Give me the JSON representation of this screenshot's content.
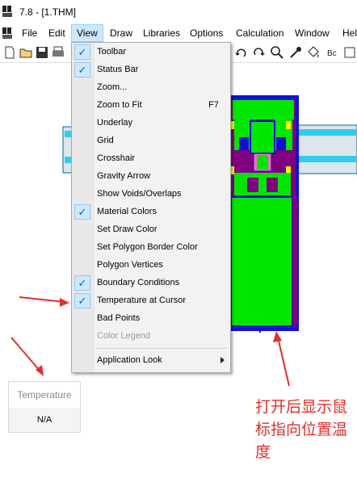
{
  "window": {
    "title": "7.8 - [1.THM]"
  },
  "menubar": {
    "items": [
      "File",
      "Edit",
      "View",
      "Draw",
      "Libraries",
      "Options",
      "Calculation",
      "Window",
      "Hel"
    ]
  },
  "view_menu": {
    "items": [
      {
        "label": "Toolbar",
        "checked": true
      },
      {
        "label": "Status Bar",
        "checked": true
      },
      {
        "label": "Zoom..."
      },
      {
        "label": "Zoom to Fit",
        "shortcut": "F7"
      },
      {
        "label": "Underlay"
      },
      {
        "label": "Grid"
      },
      {
        "label": "Crosshair"
      },
      {
        "label": "Gravity Arrow"
      },
      {
        "label": "Show Voids/Overlaps"
      },
      {
        "label": "Material Colors",
        "checked": true
      },
      {
        "label": "Set Draw Color"
      },
      {
        "label": "Set Polygon Border Color"
      },
      {
        "label": "Polygon Vertices"
      },
      {
        "label": "Boundary Conditions",
        "checked": true
      },
      {
        "label": "Temperature at Cursor",
        "checked": true
      },
      {
        "label": "Bad Points"
      },
      {
        "label": "Color Legend",
        "disabled": true
      },
      {
        "label": "Application Look",
        "submenu": true
      }
    ]
  },
  "temperature_panel": {
    "header": "Temperature",
    "value": "N/A"
  },
  "annotation": {
    "text": "打开后显示鼠标指向位置温度"
  },
  "colors": {
    "material_green": "#00e600",
    "frame_purple": "#800080",
    "gasket_blue": "#1010d0",
    "glass_cyan": "#33ccee",
    "highlight_yellow": "#ffff00",
    "arrow_red": "#e0302a",
    "menu_highlight": "#cce8ff"
  }
}
